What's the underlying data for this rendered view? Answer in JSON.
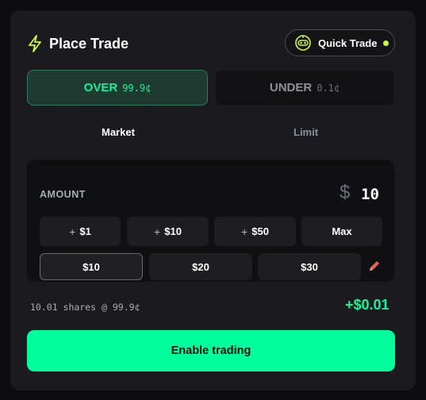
{
  "header": {
    "title": "Place Trade",
    "icon": "lightning-bolt-icon",
    "accent_color": "#cdfa3c"
  },
  "quick_trade": {
    "label": "Quick Trade",
    "icon": "robot-face-icon",
    "status_dot_color": "#cdfa3c"
  },
  "sides": [
    {
      "label": "OVER",
      "price": "99.9¢",
      "selected": true
    },
    {
      "label": "UNDER",
      "price": "0.1¢",
      "selected": false
    }
  ],
  "tabs": [
    {
      "label": "Market",
      "active": true
    },
    {
      "label": "Limit",
      "active": false
    }
  ],
  "amount": {
    "label": "AMOUNT",
    "currency_symbol": "$",
    "value": "10",
    "increments": [
      {
        "prefix": "+",
        "label": "$1"
      },
      {
        "prefix": "+",
        "label": "$10"
      },
      {
        "prefix": "+",
        "label": "$50"
      },
      {
        "prefix": "",
        "label": "Max"
      }
    ],
    "presets": [
      {
        "label": "$10",
        "selected": true
      },
      {
        "label": "$20",
        "selected": false
      },
      {
        "label": "$30",
        "selected": false
      }
    ],
    "edit_icon": "pencil-icon"
  },
  "summary": {
    "text": "10.01 shares @ 99.9¢",
    "gain": "+$0.01"
  },
  "action": {
    "label": "Enable trading",
    "color": "#00ff9c"
  },
  "colors": {
    "panel_bg": "#1b1b1f",
    "page_bg": "#0d0d0f",
    "over_green": "#0ff39a",
    "muted_text": "#8d8f99"
  }
}
